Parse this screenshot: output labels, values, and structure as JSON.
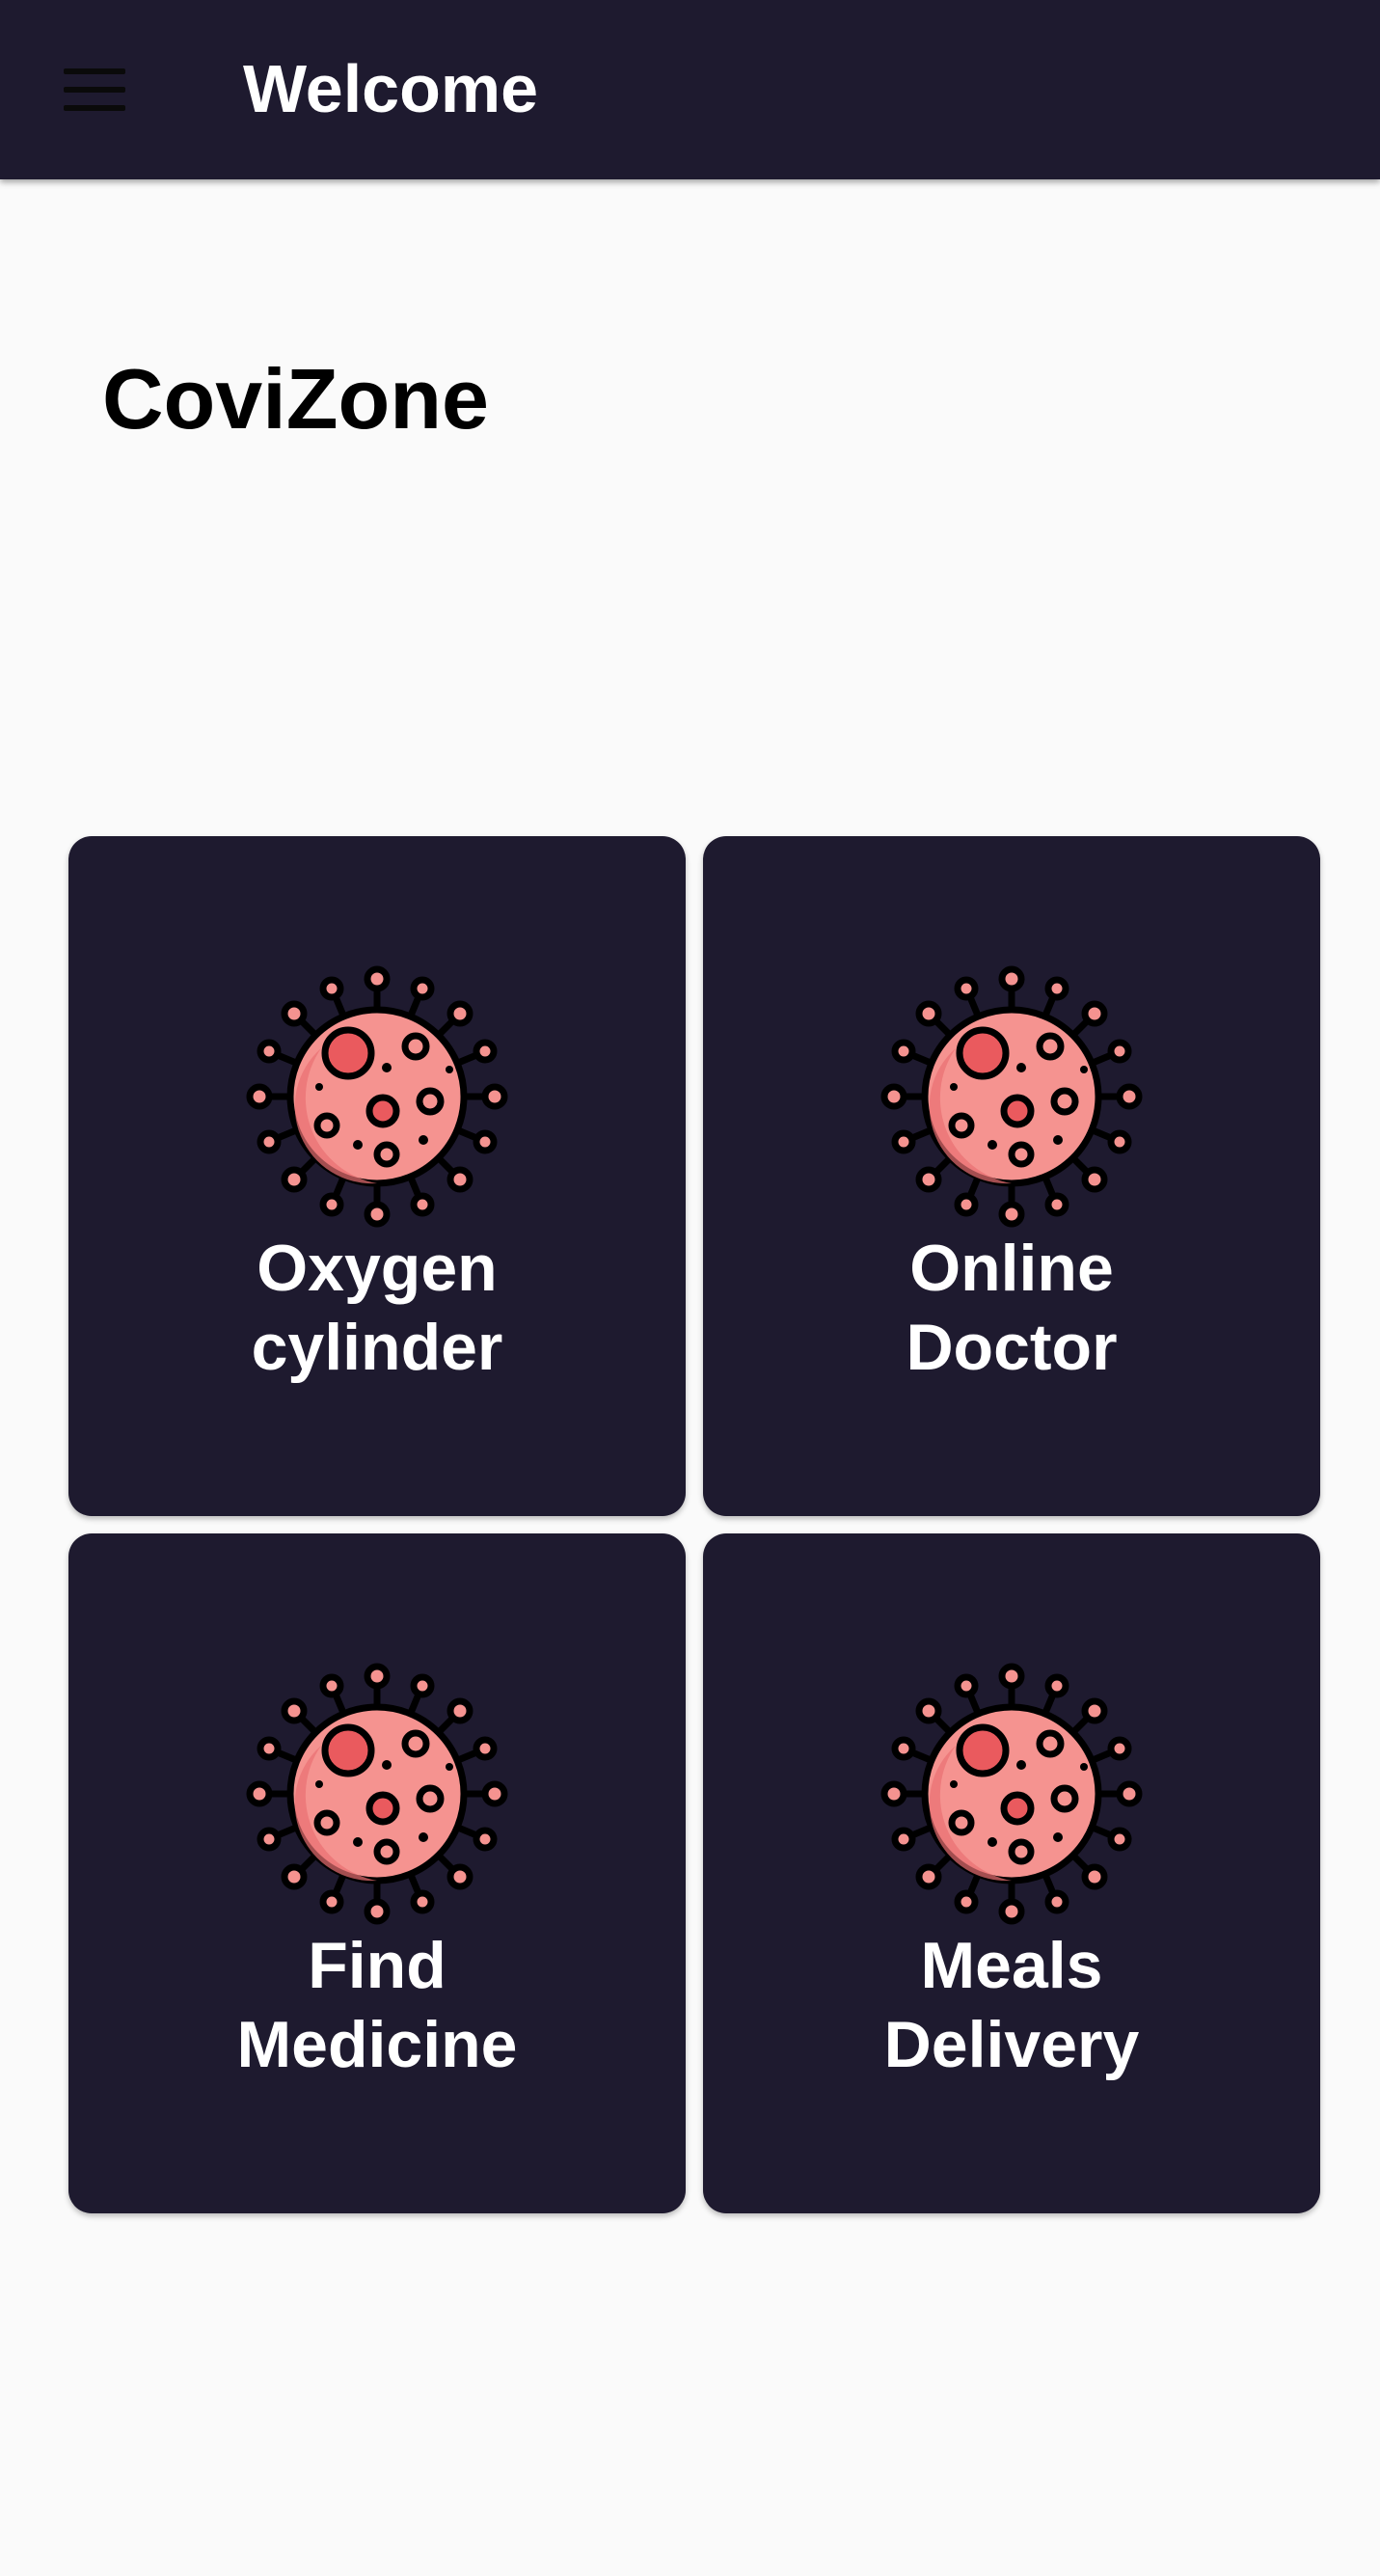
{
  "app_bar": {
    "menu_icon": "hamburger-menu-icon",
    "title": "Welcome",
    "background": "#1e1a2f"
  },
  "brand": {
    "title": "CoviZone"
  },
  "tiles": [
    {
      "label": "Oxygen\ncylinder",
      "icon": "virus-icon"
    },
    {
      "label": "Online\nDoctor",
      "icon": "virus-icon"
    },
    {
      "label": "Find\nMedicine",
      "icon": "virus-icon"
    },
    {
      "label": "Meals\nDelivery",
      "icon": "virus-icon"
    }
  ],
  "colors": {
    "tile_background": "#1e1a2f",
    "page_background": "#fafafa",
    "virus_body": "#f59390",
    "virus_spot": "#ea5a5e"
  }
}
